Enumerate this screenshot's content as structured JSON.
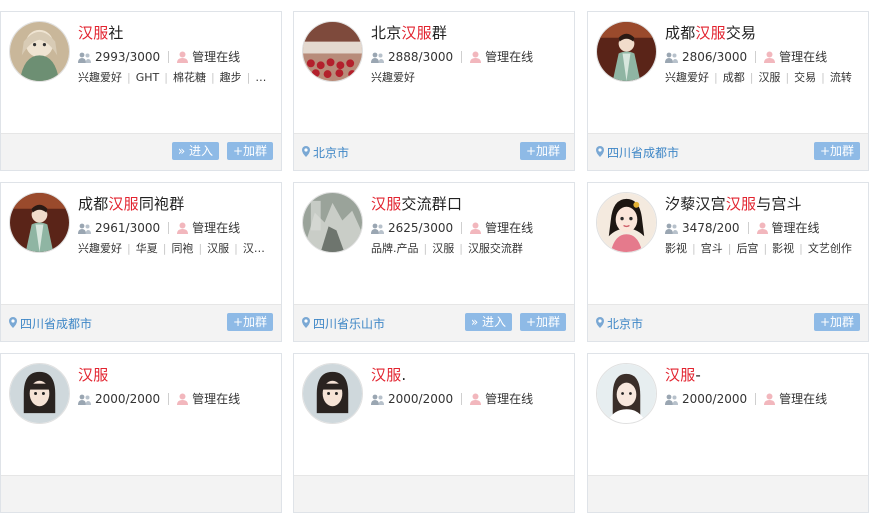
{
  "cards": [
    {
      "title_prefix": "",
      "title_highlight": "汉服",
      "title_suffix": "社",
      "members": "2993/3000",
      "admin": "管理在线",
      "tags": [
        "兴趣爱好",
        "GHT",
        "棉花糖",
        "趣步",
        "…"
      ],
      "location": "",
      "enter_label": "» 进入",
      "join_label": "+加群",
      "avatar_icon": "hanfu-girl-avatar"
    },
    {
      "title_prefix": "北京",
      "title_highlight": "汉服",
      "title_suffix": "群",
      "members": "2888/3000",
      "admin": "管理在线",
      "tags": [
        "兴趣爱好"
      ],
      "location": "北京市",
      "enter_label": "",
      "join_label": "+加群",
      "avatar_icon": "crowd-avatar"
    },
    {
      "title_prefix": "成都",
      "title_highlight": "汉服",
      "title_suffix": "交易",
      "members": "2806/3000",
      "admin": "管理在线",
      "tags": [
        "兴趣爱好",
        "成都",
        "汉服",
        "交易",
        "流转"
      ],
      "location": "四川省成都市",
      "enter_label": "",
      "join_label": "+加群",
      "avatar_icon": "hanfu-woman-avatar"
    },
    {
      "title_prefix": "成都",
      "title_highlight": "汉服",
      "title_suffix": "同袍群",
      "members": "2961/3000",
      "admin": "管理在线",
      "tags": [
        "兴趣爱好",
        "华夏",
        "同袍",
        "汉服",
        "汉…"
      ],
      "location": "四川省成都市",
      "enter_label": "",
      "join_label": "+加群",
      "avatar_icon": "hanfu-woman-avatar"
    },
    {
      "title_prefix": "",
      "title_highlight": "汉服",
      "title_suffix": "交流群口",
      "members": "2625/3000",
      "admin": "管理在线",
      "tags": [
        "品牌.产品",
        "汉服",
        "汉服交流群"
      ],
      "location": "四川省乐山市",
      "enter_label": "» 进入",
      "join_label": "+加群",
      "avatar_icon": "stone-sculpture-avatar"
    },
    {
      "title_prefix": "汐藜汉宫",
      "title_highlight": "汉服",
      "title_suffix": "与宫斗",
      "members": "3478/200",
      "admin": "管理在线",
      "tags": [
        "影视",
        "宫斗",
        "后宫",
        "影视",
        "文艺创作"
      ],
      "location": "北京市",
      "enter_label": "",
      "join_label": "+加群",
      "avatar_icon": "painted-lady-avatar"
    },
    {
      "title_prefix": "",
      "title_highlight": "汉服",
      "title_suffix": "",
      "members": "2000/2000",
      "admin": "管理在线",
      "tags": [],
      "location": "",
      "enter_label": "",
      "join_label": "",
      "avatar_icon": "girl-photo-avatar"
    },
    {
      "title_prefix": "",
      "title_highlight": "汉服",
      "title_suffix": ".",
      "members": "2000/2000",
      "admin": "管理在线",
      "tags": [],
      "location": "",
      "enter_label": "",
      "join_label": "",
      "avatar_icon": "girl-photo-avatar"
    },
    {
      "title_prefix": "",
      "title_highlight": "汉服",
      "title_suffix": "-",
      "members": "2000/2000",
      "admin": "管理在线",
      "tags": [],
      "location": "",
      "enter_label": "",
      "join_label": "",
      "avatar_icon": "girl-white-avatar"
    }
  ],
  "colors": {
    "highlight": "#e2232f",
    "button_bg": "#8ebae6",
    "location_text": "#3d86c6",
    "footer_bg": "#f3f3f3",
    "border": "#dfe3e8"
  }
}
